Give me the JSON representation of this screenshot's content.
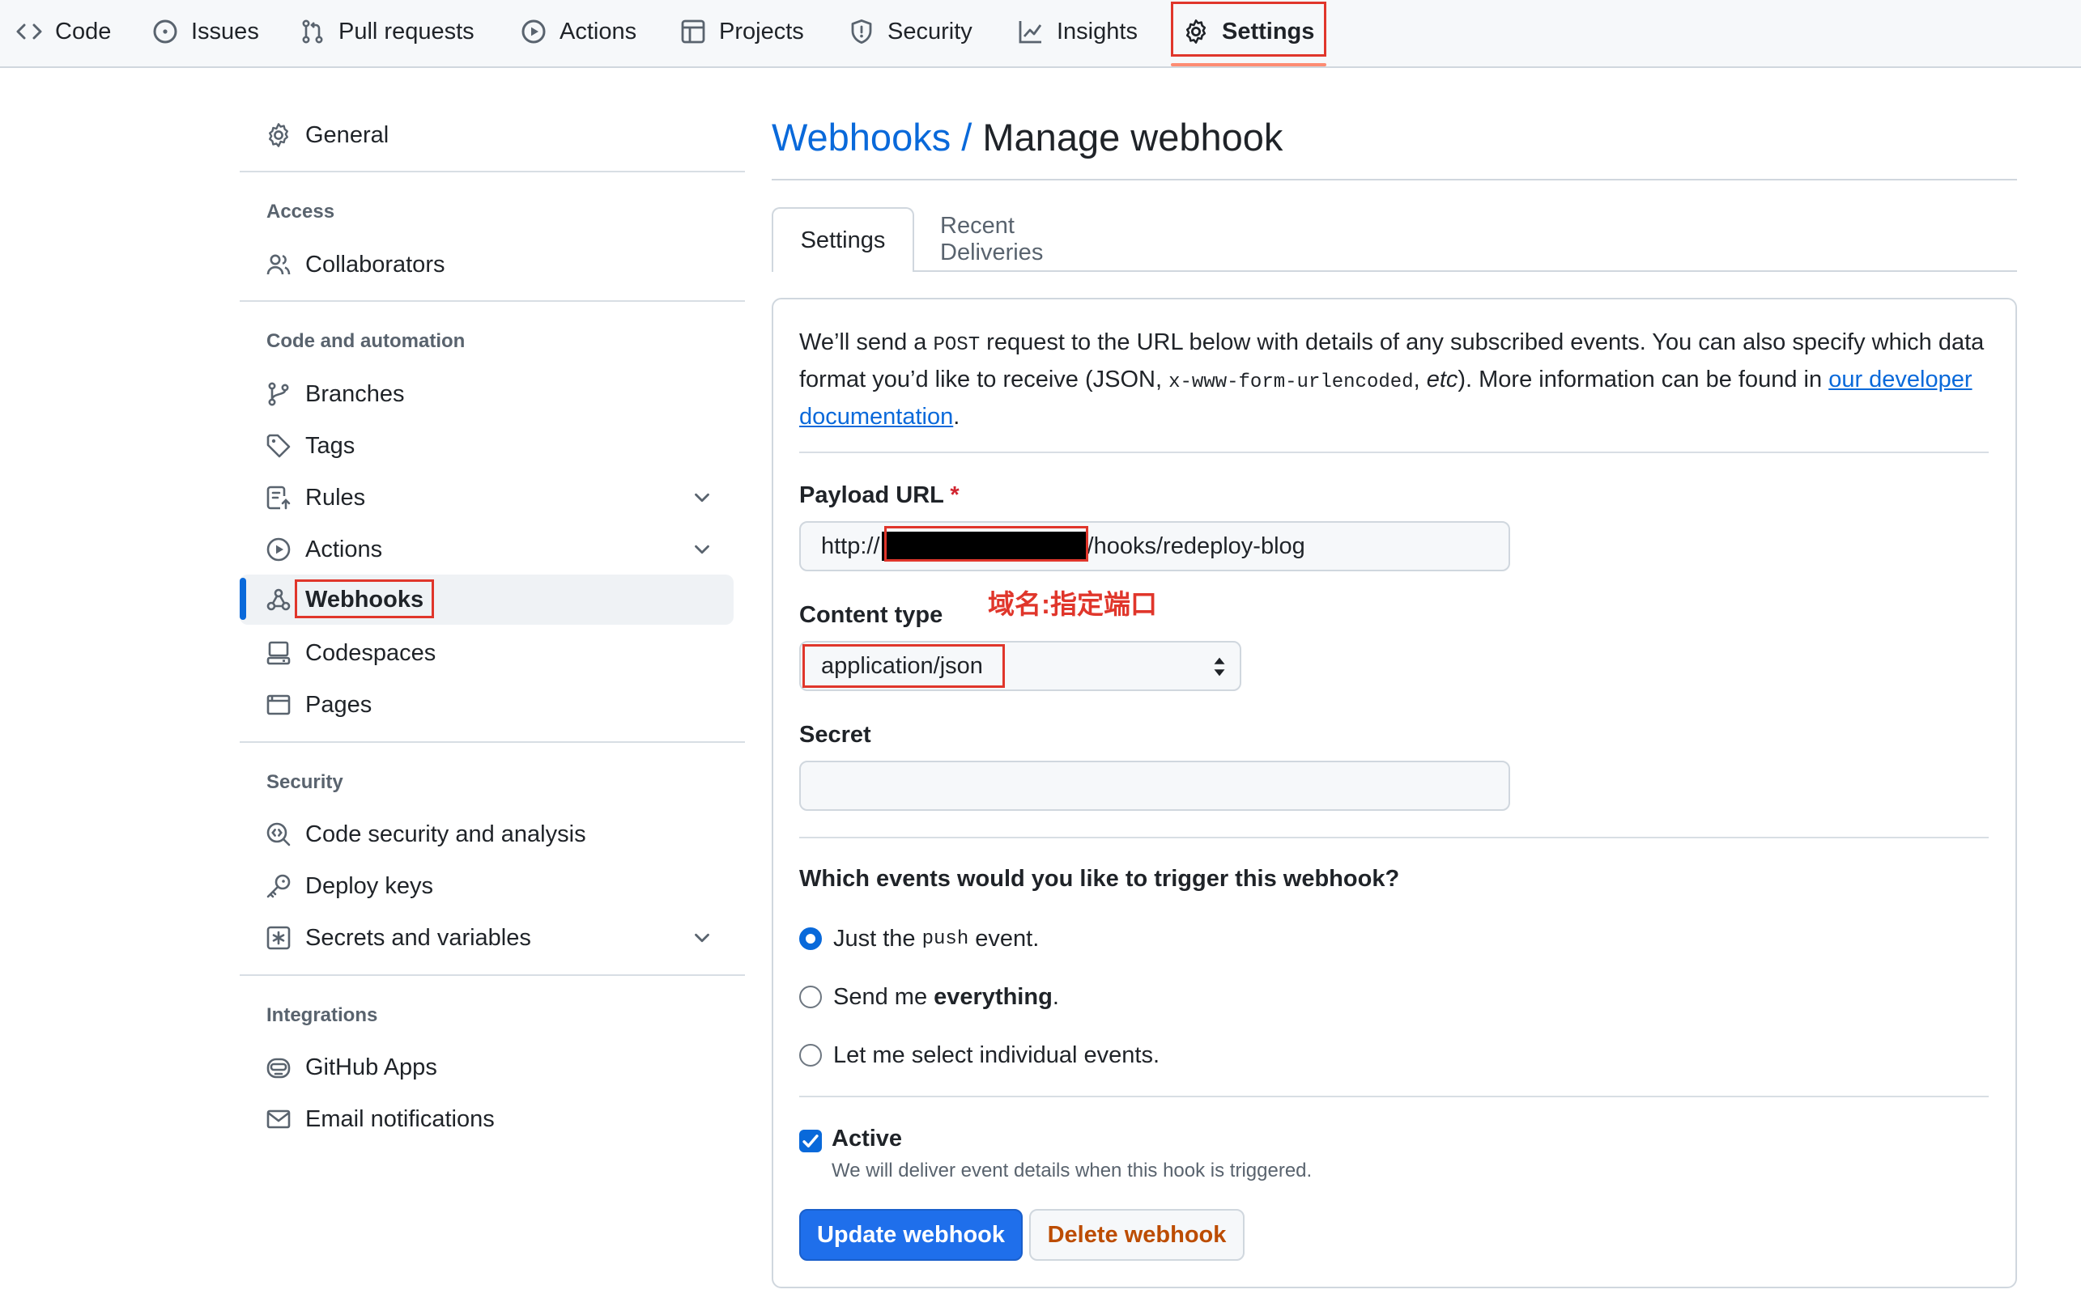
{
  "nav": {
    "tabs": [
      {
        "label": "Code",
        "icon": "code-icon"
      },
      {
        "label": "Issues",
        "icon": "issue-icon"
      },
      {
        "label": "Pull requests",
        "icon": "pull-request-icon"
      },
      {
        "label": "Actions",
        "icon": "play-icon"
      },
      {
        "label": "Projects",
        "icon": "table-icon"
      },
      {
        "label": "Security",
        "icon": "shield-icon"
      },
      {
        "label": "Insights",
        "icon": "graph-icon"
      },
      {
        "label": "Settings",
        "icon": "gear-icon"
      }
    ],
    "active": "Settings"
  },
  "sidebar": {
    "general": "General",
    "sections": {
      "access": "Access",
      "code_automation": "Code and automation",
      "security": "Security",
      "integrations": "Integrations"
    },
    "items": {
      "collaborators": "Collaborators",
      "branches": "Branches",
      "tags": "Tags",
      "rules": "Rules",
      "actions": "Actions",
      "webhooks": "Webhooks",
      "codespaces": "Codespaces",
      "pages": "Pages",
      "code_security": "Code security and analysis",
      "deploy_keys": "Deploy keys",
      "secrets": "Secrets and variables",
      "github_apps": "GitHub Apps",
      "email_notifications": "Email notifications"
    }
  },
  "main": {
    "breadcrumb": "Webhooks /",
    "title": "Manage webhook",
    "tabs": {
      "settings": "Settings",
      "deliveries": "Recent Deliveries"
    },
    "intro": {
      "p1": "We’ll send a ",
      "code1": "POST",
      "p2": " request to the URL below with details of any subscribed events. You can also specify which data format you’d like to receive (JSON, ",
      "code2": "x-www-form-urlencoded",
      "p3": ", ",
      "em": "etc",
      "p4": "). More information can be found in ",
      "link": "our developer documentation",
      "p5": "."
    },
    "payload_url": {
      "label": "Payload URL",
      "required": "*",
      "prefix": "http://",
      "suffix": "/hooks/redeploy-blog"
    },
    "annotation": "域名:指定端口",
    "content_type": {
      "label": "Content type",
      "value": "application/json"
    },
    "secret": {
      "label": "Secret",
      "value": ""
    },
    "events": {
      "question": "Which events would you like to trigger this webhook?",
      "opt1_a": "Just the ",
      "opt1_code": "push",
      "opt1_b": " event.",
      "opt2_a": "Send me ",
      "opt2_bold": "everything",
      "opt2_b": ".",
      "opt3": "Let me select individual events.",
      "selected": 1
    },
    "active": {
      "label": "Active",
      "note": "We will deliver event details when this hook is triggered.",
      "checked": true
    },
    "buttons": {
      "update": "Update webhook",
      "delete": "Delete webhook"
    }
  },
  "colors": {
    "accent": "#0969da",
    "annotation": "#e0362b",
    "danger": "#bc4c00",
    "primary_button": "#1f6feb"
  }
}
